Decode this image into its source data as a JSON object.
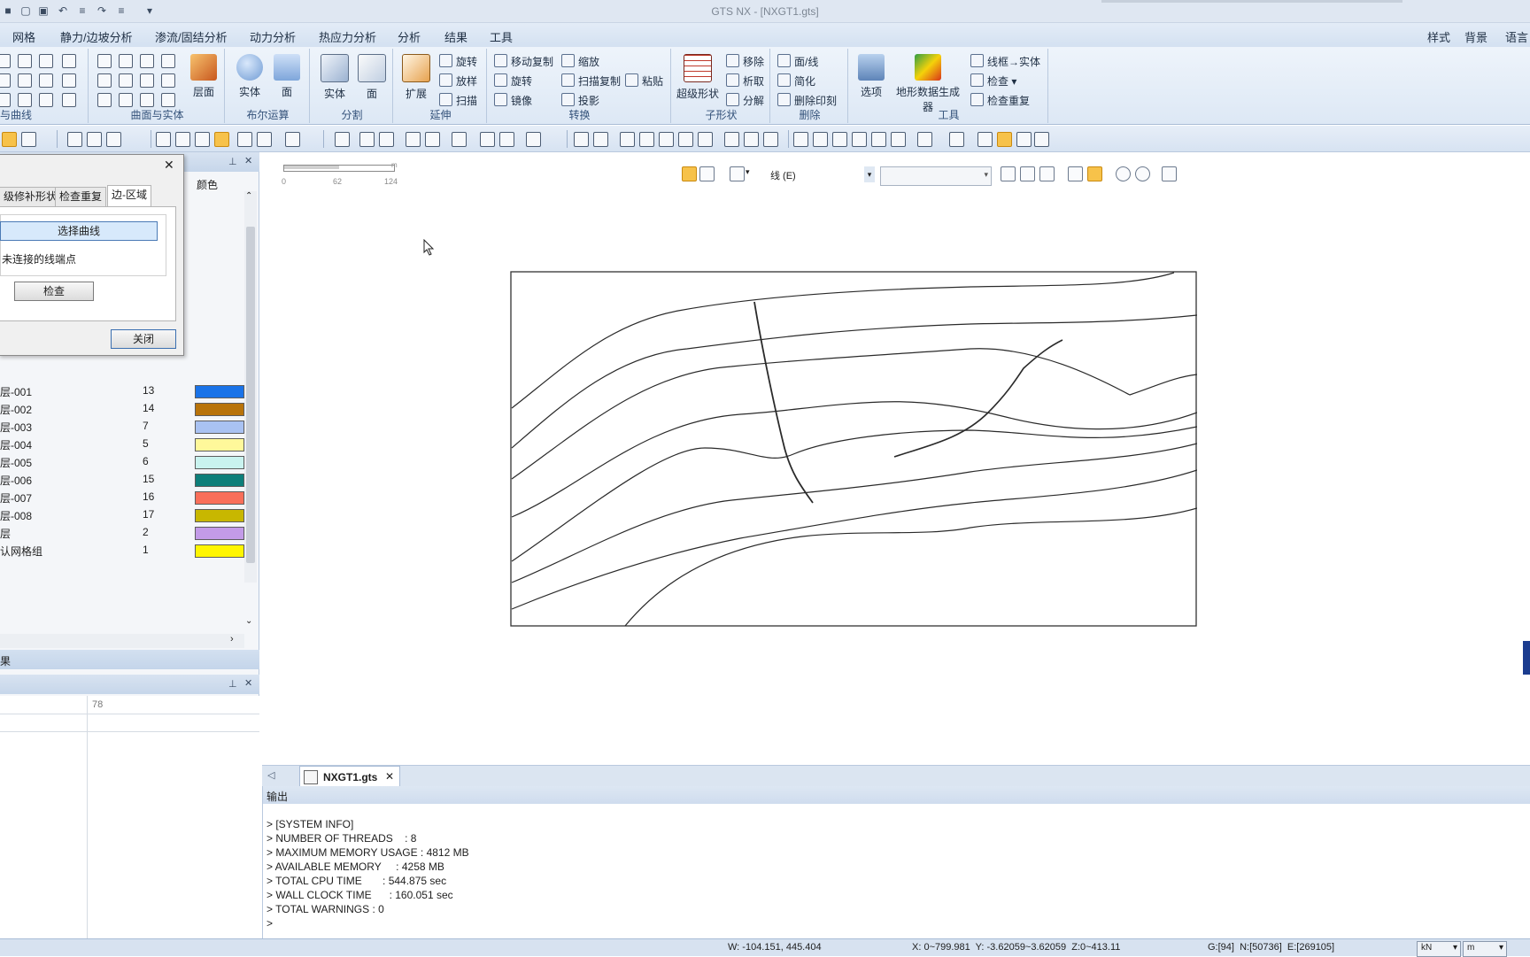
{
  "app": {
    "title": "GTS NX - [NXGT1.gts]"
  },
  "menu": {
    "items": [
      "网格",
      "静力/边坡分析",
      "渗流/固结分析",
      "动力分析",
      "热应力分析",
      "分析",
      "结果",
      "工具"
    ],
    "right": [
      "样式",
      "背景",
      "语言"
    ]
  },
  "ribbon": {
    "groups": {
      "curves": "与曲线",
      "surface_solid": "曲面与实体",
      "boolean": "布尔运算",
      "split": "分割",
      "extend": "延伸",
      "transform": "转换",
      "subshape": "子形状",
      "delete": "删除",
      "tools": "工具"
    },
    "buttons": {
      "layer": "层面",
      "solid1": "实体",
      "face1": "面",
      "solid2": "实体",
      "face2": "面",
      "extend": "扩展",
      "revolve": "旋转",
      "loft": "放样",
      "sweep": "扫描",
      "move_copy": "移动复制",
      "rotate": "旋转",
      "mirror": "镜像",
      "scale": "缩放",
      "sweep_copy": "扫描复制",
      "project": "投影",
      "paste": "粘贴",
      "super_shape": "超级形状",
      "remove": "移除",
      "extract": "析取",
      "decompose": "分解",
      "face_line": "面/线",
      "simplify": "简化",
      "delete_imprint": "删除印刻",
      "options": "选项",
      "terrain": "地形数据生成器",
      "wire_to_solid": "线框→实体",
      "check": "检查",
      "check_duplicate": "检查重复"
    }
  },
  "dialog": {
    "tabs": [
      "级修补形状",
      "检查重复",
      "边-区域"
    ],
    "select_curve": "选择曲线",
    "unconnected": "未连接的线端点",
    "check": "检查",
    "close": "关闭"
  },
  "panel": {
    "color_header": "颜色",
    "layers": [
      {
        "name": "层-001",
        "count": "13",
        "color": "#1a73e8"
      },
      {
        "name": "层-002",
        "count": "14",
        "color": "#b8730a"
      },
      {
        "name": "层-003",
        "count": "7",
        "color": "#a9c2f2"
      },
      {
        "name": "层-004",
        "count": "5",
        "color": "#fff89a"
      },
      {
        "name": "层-005",
        "count": "6",
        "color": "#c9f3ef"
      },
      {
        "name": "层-006",
        "count": "15",
        "color": "#0e7f7a"
      },
      {
        "name": "层-007",
        "count": "16",
        "color": "#f96f5a"
      },
      {
        "name": "层-008",
        "count": "17",
        "color": "#c8b700"
      },
      {
        "name": "层",
        "count": "2",
        "color": "#c39be8"
      },
      {
        "name": "认网格组",
        "count": "1",
        "color": "#fff500"
      }
    ],
    "results_label": "果",
    "results_value": "78"
  },
  "viewport": {
    "scale_labels": [
      "0",
      "62",
      "124"
    ],
    "scale_unit": "m",
    "filter_label": "线 (E)"
  },
  "doc_tab": {
    "label": "NXGT1.gts"
  },
  "output": {
    "header": "输出",
    "lines": [
      "> [SYSTEM INFO]",
      "> NUMBER OF THREADS    : 8",
      "> MAXIMUM MEMORY USAGE : 4812 MB",
      "> AVAILABLE MEMORY     : 4258 MB",
      "> TOTAL CPU TIME       : 544.875 sec",
      "> WALL CLOCK TIME      : 160.051 sec",
      "> TOTAL WARNINGS : 0",
      ">"
    ]
  },
  "status": {
    "w": "W: -104.151, 445.404",
    "xyz": "X: 0~799.981  Y: -3.62059~3.62059  Z:0~413.11",
    "counts": "G:[94]  N:[50736]  E:[269105]",
    "force_unit": "kN",
    "length_unit": "m"
  }
}
